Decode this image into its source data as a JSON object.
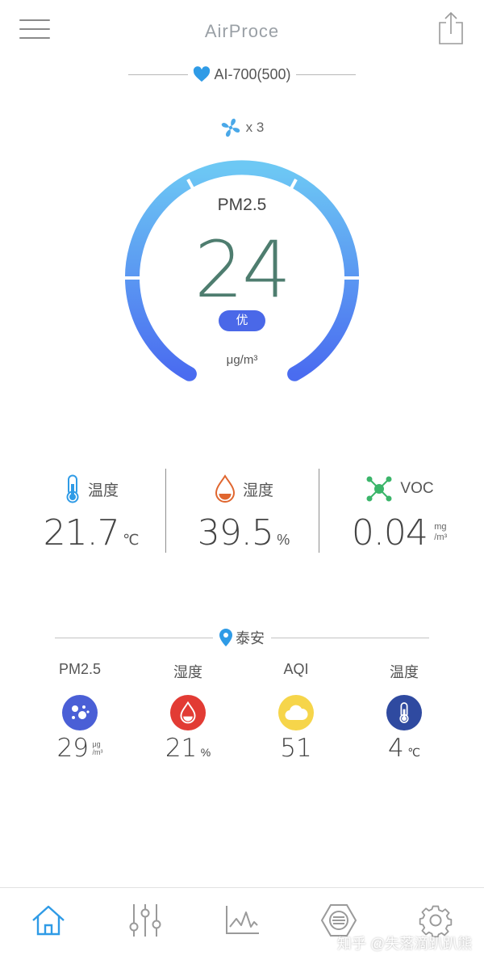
{
  "header": {
    "title": "AirProce"
  },
  "device": {
    "name": "AI-700(500)"
  },
  "fan": {
    "level_text": "x 3"
  },
  "gauge": {
    "label": "PM2.5",
    "value": "24",
    "quality": "优",
    "unit": "μg/m³"
  },
  "indoor": [
    {
      "label": "温度",
      "value": "21.7",
      "unit": "℃",
      "icon": "thermometer-icon"
    },
    {
      "label": "湿度",
      "value": "39.5",
      "unit": "%",
      "icon": "droplet-icon"
    },
    {
      "label": "VOC",
      "value": "0.04",
      "unit_top": "mg",
      "unit_bottom": "/m³",
      "icon": "molecule-icon"
    }
  ],
  "location": {
    "name": "泰安"
  },
  "outdoor": [
    {
      "label": "PM2.5",
      "value": "29",
      "unit_top": "μg",
      "unit_bottom": "/m³",
      "color": "#4a5fd6",
      "icon": "particles-icon"
    },
    {
      "label": "湿度",
      "value": "21",
      "unit": "%",
      "color": "#e23b34",
      "icon": "droplet-icon"
    },
    {
      "label": "AQI",
      "value": "51",
      "color": "#f6d54a",
      "icon": "cloud-icon"
    },
    {
      "label": "温度",
      "value": "4",
      "unit": "℃",
      "color": "#2f4aa0",
      "icon": "thermometer-icon"
    }
  ],
  "nav": [
    {
      "icon": "home-icon",
      "active": true
    },
    {
      "icon": "sliders-icon"
    },
    {
      "icon": "chart-icon"
    },
    {
      "icon": "filter-icon"
    },
    {
      "icon": "gear-icon"
    }
  ],
  "watermark": "知乎 @失落滴趴趴熊",
  "colors": {
    "accent": "#2f9be6",
    "gauge_top": "#6dc8f4",
    "gauge_bottom": "#4a6cf0",
    "value": "#4e7d6f"
  }
}
